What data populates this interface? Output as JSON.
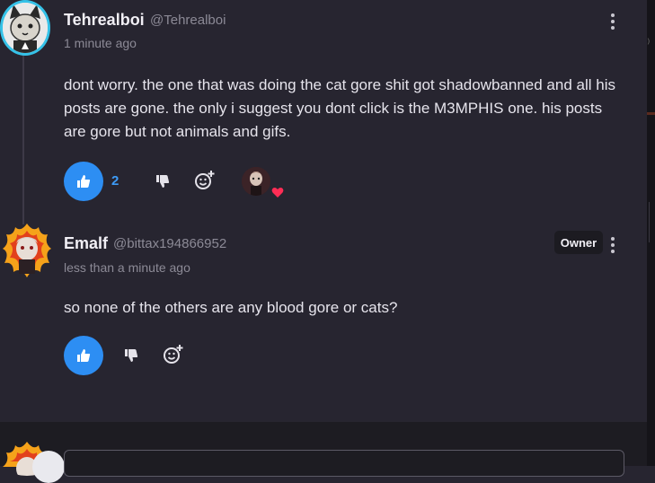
{
  "comments": [
    {
      "author": "Tehrealboi",
      "handle": "@Tehrealboi",
      "time": "1 minute ago",
      "text": "dont worry. the one that was doing the cat gore shit got shadowbanned and all his posts are gone. the only i suggest you dont click is the M3MPHIS one. his posts are gore but not animals and gifs.",
      "like_count": "2",
      "avatar_icon": "avatar-cat-icon",
      "reaction": "heart-icon"
    },
    {
      "author": "Emalf",
      "handle": "@bittax194866952",
      "time": "less than a minute ago",
      "badge": "Owner",
      "text": "so none of the others are any blood gore or cats?",
      "avatar_icon": "avatar-fire-icon"
    }
  ],
  "colors": {
    "background": "#272530",
    "accent_blue": "#2d8ef3",
    "avatar_ring": "#35c2e8",
    "heart": "#ff2d55"
  }
}
